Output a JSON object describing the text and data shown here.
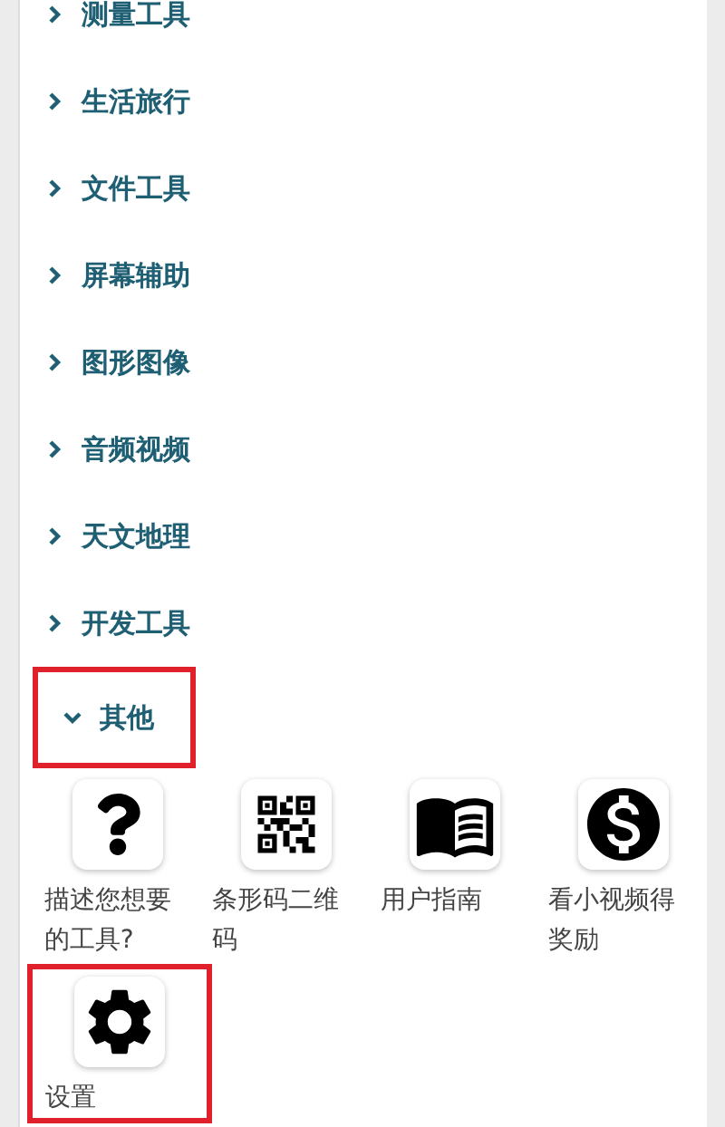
{
  "categories": [
    {
      "label": "测量工具",
      "expanded": false,
      "highlighted": false
    },
    {
      "label": "生活旅行",
      "expanded": false,
      "highlighted": false
    },
    {
      "label": "文件工具",
      "expanded": false,
      "highlighted": false
    },
    {
      "label": "屏幕辅助",
      "expanded": false,
      "highlighted": false
    },
    {
      "label": "图形图像",
      "expanded": false,
      "highlighted": false
    },
    {
      "label": "音频视频",
      "expanded": false,
      "highlighted": false
    },
    {
      "label": "天文地理",
      "expanded": false,
      "highlighted": false
    },
    {
      "label": "开发工具",
      "expanded": false,
      "highlighted": false
    },
    {
      "label": "其他",
      "expanded": true,
      "highlighted": true,
      "tools": [
        {
          "kind": "question",
          "label": "描述您想要的工具?",
          "highlighted": false
        },
        {
          "kind": "qrcode",
          "label": "条形码二维码",
          "highlighted": false
        },
        {
          "kind": "book",
          "label": "用户指南",
          "highlighted": false
        },
        {
          "kind": "coin",
          "label": "看小视频得奖励",
          "highlighted": false
        },
        {
          "kind": "gear",
          "label": "设置",
          "highlighted": true
        }
      ]
    }
  ]
}
